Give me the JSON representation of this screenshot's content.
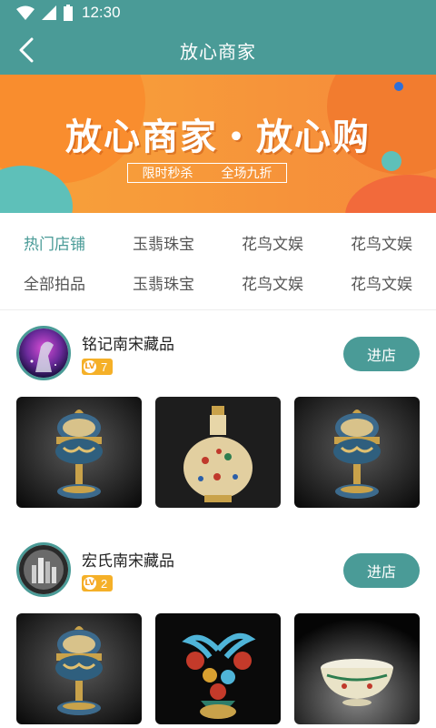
{
  "status_bar": {
    "time": "12:30"
  },
  "nav": {
    "title": "放心商家"
  },
  "banner": {
    "title": "放心商家・放心购",
    "sub_left": "限时秒杀",
    "sub_right": "全场九折"
  },
  "categories": {
    "row1": [
      "热门店铺",
      "玉翡珠宝",
      "花鸟文娱",
      "花鸟文娱"
    ],
    "row2": [
      "全部拍品",
      "玉翡珠宝",
      "花鸟文娱",
      "花鸟文娱"
    ]
  },
  "shops": [
    {
      "name": "铭记南宋藏品",
      "level": "7",
      "enter_label": "进店"
    },
    {
      "name": "宏氏南宋藏品",
      "level": "2",
      "enter_label": "进店"
    }
  ],
  "colors": {
    "theme": "#4a9b97",
    "banner": "#f79a3a",
    "badge": "#f5b028"
  }
}
